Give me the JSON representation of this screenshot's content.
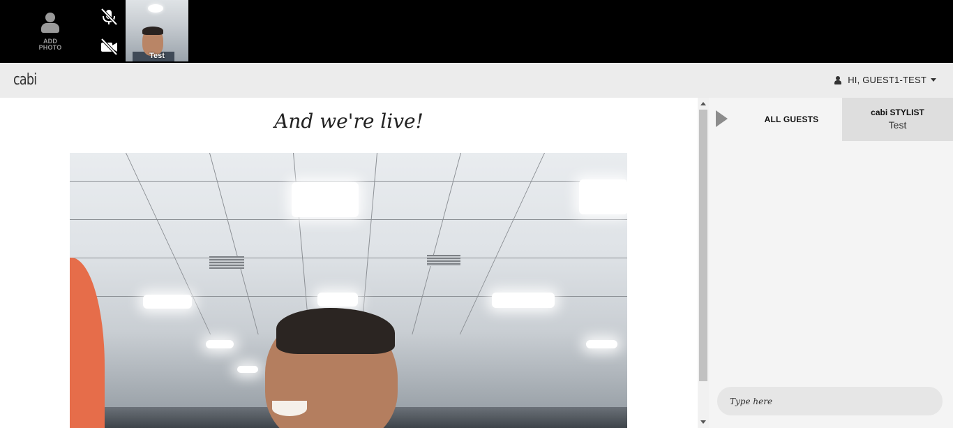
{
  "topbar": {
    "add_photo_label": "ADD\nPHOTO",
    "thumbnail_name": "Test",
    "mic_state": "muted",
    "camera_state": "off"
  },
  "header": {
    "logo": "cabi",
    "user_greeting": "HI, GUEST1-TEST"
  },
  "main": {
    "title": "And we're live!"
  },
  "chat": {
    "tabs": [
      {
        "label": "ALL GUESTS"
      },
      {
        "label": "cabi STYLIST",
        "sublabel": "Test"
      }
    ],
    "input_placeholder": "Type here"
  },
  "colors": {
    "topbar_bg": "#000000",
    "header_bg": "#ececec",
    "chat_bg": "#f4f4f4",
    "stylist_tab_bg": "#dedede"
  }
}
